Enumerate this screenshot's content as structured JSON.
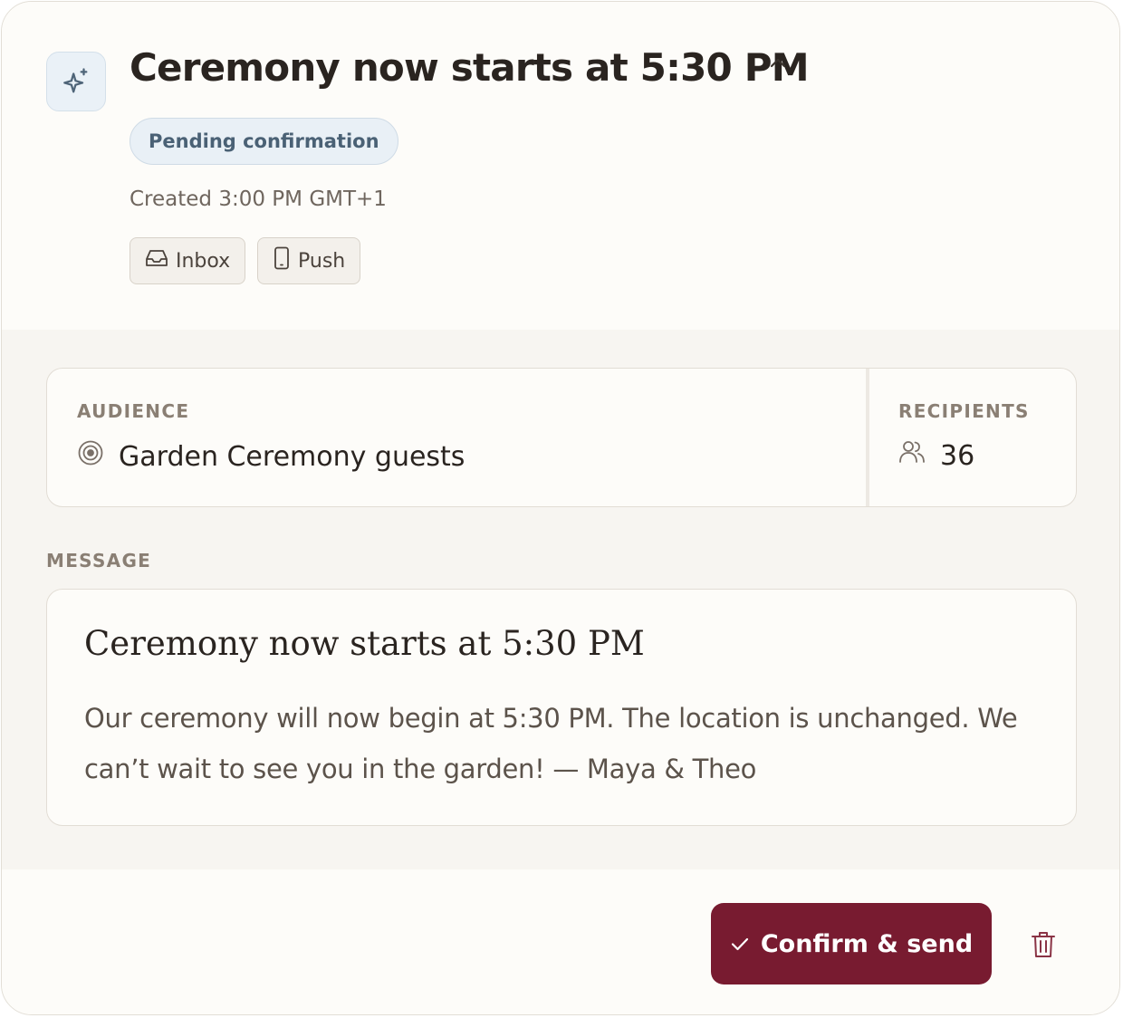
{
  "notification": {
    "title": "Ceremony now starts at 5:30 PM",
    "status": "Pending confirmation",
    "created": "Created 3:00 PM GMT+1",
    "channels": [
      {
        "label": "Inbox",
        "icon": "inbox-icon"
      },
      {
        "label": "Push",
        "icon": "phone-icon"
      }
    ]
  },
  "audience": {
    "label": "AUDIENCE",
    "value": "Garden Ceremony guests",
    "icon": "target-icon"
  },
  "recipients": {
    "label": "RECIPIENTS",
    "value": "36",
    "icon": "users-icon"
  },
  "message": {
    "label": "MESSAGE",
    "title": "Ceremony now starts at 5:30 PM",
    "body": "Our ceremony will now begin at 5:30 PM. The location is unchanged. We can’t wait to see you in the garden! — Maya & Theo"
  },
  "actions": {
    "confirm_label": "Confirm & send"
  },
  "colors": {
    "accent": "#781b30",
    "status_bg": "#e9f0f6",
    "status_text": "#4a6175"
  }
}
